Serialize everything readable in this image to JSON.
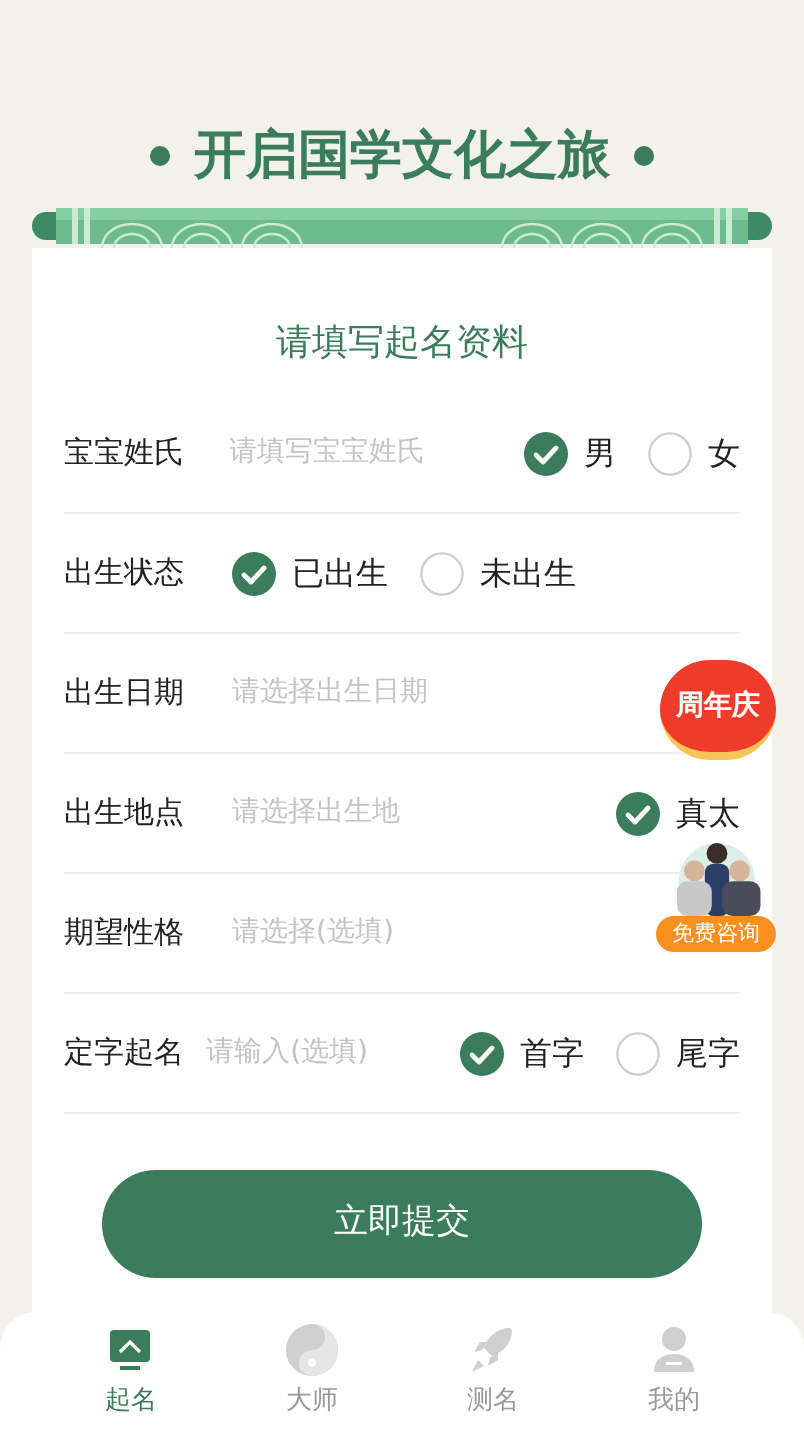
{
  "banner": {
    "title": "开启国学文化之旅"
  },
  "form": {
    "heading": "请填写起名资料",
    "rows": [
      {
        "label": "宝宝姓氏",
        "placeholder": "请填写宝宝姓氏",
        "options": [
          {
            "label": "男",
            "selected": true
          },
          {
            "label": "女",
            "selected": false
          }
        ]
      },
      {
        "label": "出生状态",
        "options": [
          {
            "label": "已出生",
            "selected": true
          },
          {
            "label": "未出生",
            "selected": false
          }
        ]
      },
      {
        "label": "出生日期",
        "placeholder": "请选择出生日期"
      },
      {
        "label": "出生地点",
        "placeholder": "请选择出生地",
        "options": [
          {
            "label": "真太",
            "selected": true
          }
        ]
      },
      {
        "label": "期望性格",
        "placeholder": "请选择(选填)"
      },
      {
        "label": "定字起名",
        "placeholder": "请输入(选填)",
        "options": [
          {
            "label": "首字",
            "selected": true
          },
          {
            "label": "尾字",
            "selected": false
          }
        ]
      }
    ],
    "submit": "立即提交"
  },
  "floating": {
    "promo": "周年庆",
    "consult": "免费咨询"
  },
  "tabs": [
    {
      "label": "起名",
      "kind": "screen",
      "selected": true
    },
    {
      "label": "大师",
      "kind": "yinyang",
      "selected": false
    },
    {
      "label": "测名",
      "kind": "rocket",
      "selected": false
    },
    {
      "label": "我的",
      "kind": "person",
      "selected": false
    }
  ]
}
